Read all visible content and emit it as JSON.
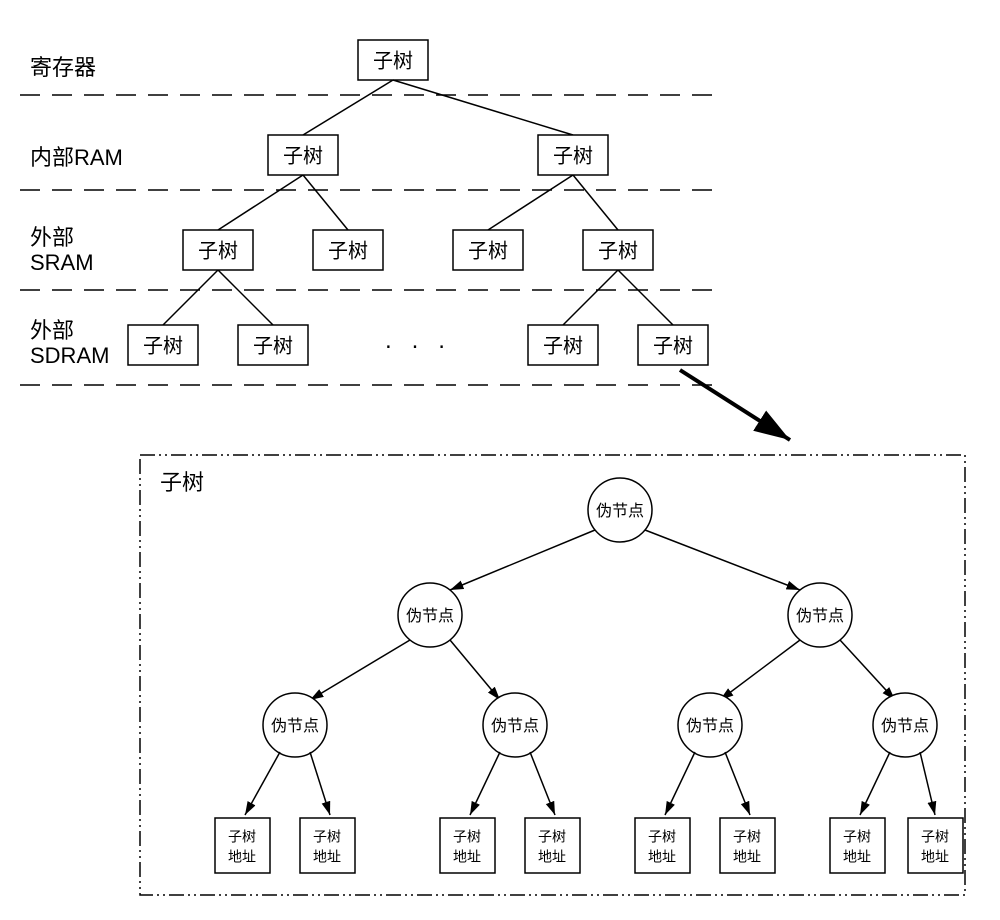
{
  "memoryLevels": {
    "level1": "寄存器",
    "level2": "内部RAM",
    "level3_a": "外部",
    "level3_b": "SRAM",
    "level4_a": "外部",
    "level4_b": "SDRAM"
  },
  "nodeLabel": "子树",
  "ellipsis": "· · ·",
  "subtree": {
    "title": "子树",
    "pseudoNode": "伪节点",
    "leaf_a": "子树",
    "leaf_b": "地址"
  }
}
